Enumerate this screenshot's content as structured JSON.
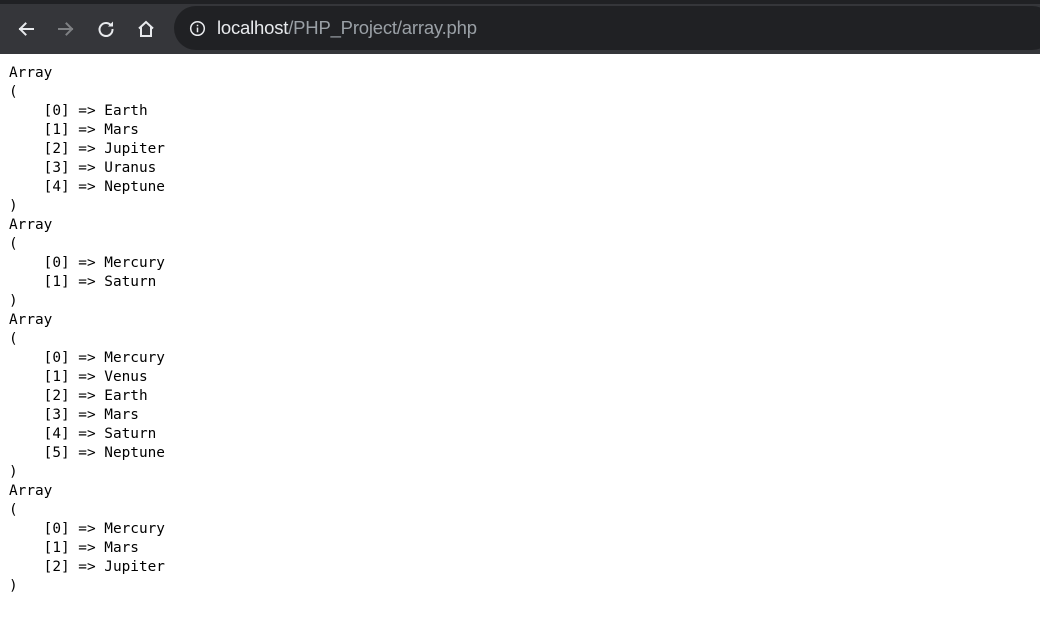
{
  "browser": {
    "url_host": "localhost",
    "url_path": "/PHP_Project/array.php",
    "icons": {
      "back": "arrow-left-icon",
      "forward": "arrow-right-icon",
      "reload": "reload-icon",
      "home": "home-icon",
      "site_info": "info-icon"
    },
    "colors": {
      "toolbar": "#35363a",
      "omnibox": "#202124",
      "host_text": "#e8eaed",
      "path_text": "#9aa0a6"
    }
  },
  "page": {
    "output": "Array\n(\n    [0] => Earth\n    [1] => Mars\n    [2] => Jupiter\n    [3] => Uranus\n    [4] => Neptune\n)\nArray\n(\n    [0] => Mercury\n    [1] => Saturn\n)\nArray\n(\n    [0] => Mercury\n    [1] => Venus\n    [2] => Earth\n    [3] => Mars\n    [4] => Saturn\n    [5] => Neptune\n)\nArray\n(\n    [0] => Mercury\n    [1] => Mars\n    [2] => Jupiter\n)"
  }
}
